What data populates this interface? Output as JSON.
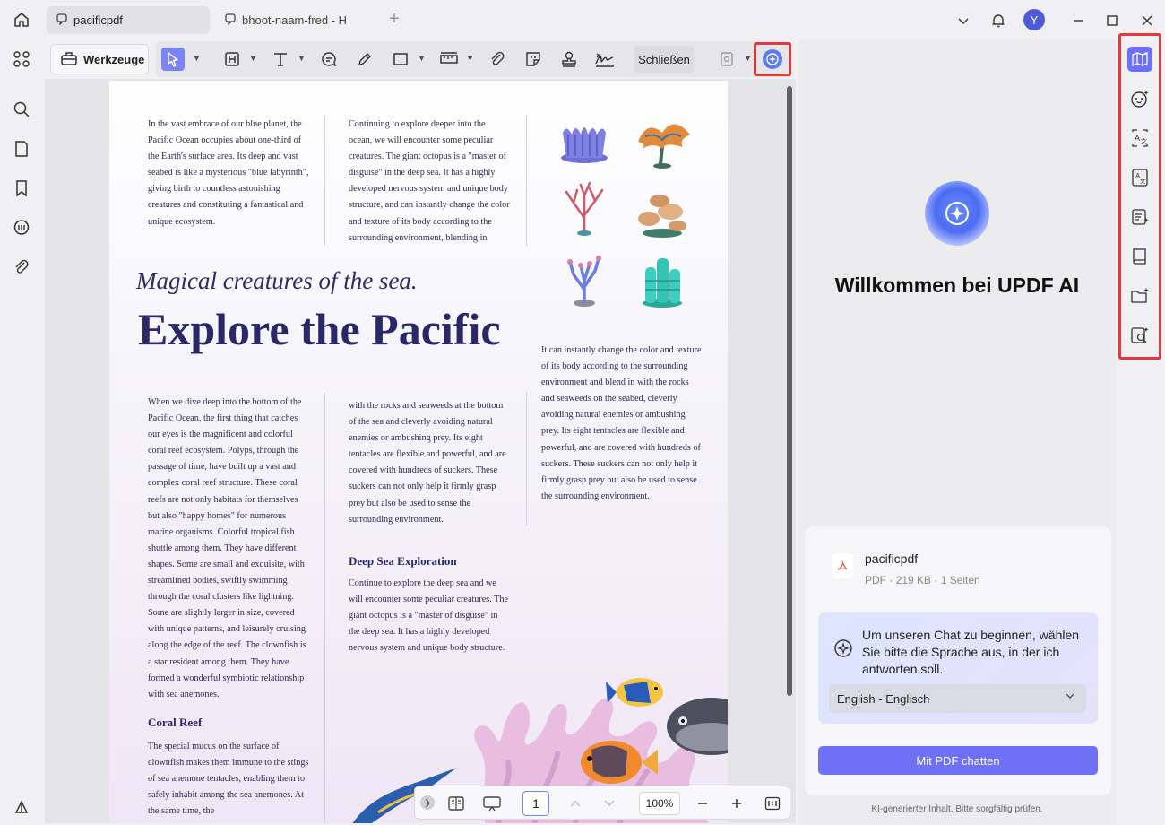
{
  "tabs": {
    "active_label": "pacificpdf",
    "inactive_label": "bhoot-naam-fred - H"
  },
  "user": {
    "avatar_initial": "Y"
  },
  "toolbar": {
    "tools_label": "Werkzeuge",
    "close_label": "Schließen"
  },
  "document": {
    "col1_top": "In the vast embrace of our blue planet, the Pacific Ocean occupies about one-third of the Earth's surface area. Its deep and vast seabed is like a mysterious \"blue labyrinth\", giving birth to countless astonishing creatures and constituting a fantastical and unique ecosystem.",
    "col2_top": "Continuing to explore deeper into the ocean, we will encounter some peculiar creatures. The giant octopus is a \"master of disguise\" in the deep sea. It has a highly developed nervous system and unique body structure, and can instantly change the color and texture of its body according to the surrounding environment, blending in",
    "subtitle": "Magical creatures of the sea.",
    "title": "Explore the Pacific",
    "col3_mid": "It can instantly change the color and texture of its body according to the surrounding environment and blend in with the rocks and seaweeds on the seabed, cleverly avoiding natural enemies or ambushing prey. Its eight tentacles are flexible and powerful, and are covered with hundreds of suckers. These suckers can not only help it firmly grasp prey but also be used to sense the surrounding environment.",
    "col1_bottom": "When we dive deep into the bottom of the Pacific Ocean, the first thing that catches our eyes is the magnificent and colorful coral reef ecosystem. Polyps, through the passage of time, have built up a vast and complex coral reef structure. These coral reefs are not only habitats for themselves but also \"happy homes\" for numerous marine organisms. Colorful tropical fish shuttle among them. They have different shapes. Some are small and exquisite, with streamlined bodies, swiftly swimming through the coral clusters like lightning. Some are slightly larger in size, covered with unique patterns, and leisurely cruising along the edge of the reef. The clownfish is a star resident among them. They have formed a wonderful symbiotic relationship with sea anemones.",
    "col2_bottom": "with the rocks and seaweeds at the bottom of the sea and cleverly avoiding natural enemies or ambushing prey. Its eight tentacles are flexible and powerful, and are covered with hundreds of suckers. These suckers can not only help it firmly grasp prey but also be used to sense the surrounding environment.",
    "heading_deep": "Deep Sea Exploration",
    "deep_text": "Continue to explore the deep sea and we will encounter some peculiar creatures. The giant octopus is a \"master of disguise\" in the deep sea. It has a highly developed nervous system and unique body structure.",
    "heading_coral": "Coral Reef",
    "coral_text": "The special mucus on the surface of clownfish makes them immune to the stings of sea anemone tentacles, enabling them to safely inhabit among the sea anemones. At the same time, the"
  },
  "nav": {
    "page_number": "1",
    "zoom": "100%"
  },
  "ai_panel": {
    "welcome": "Willkommen bei UPDF AI",
    "file_name": "pacificpdf",
    "file_meta": "PDF · 219 KB · 1 Seiten",
    "language_prompt": "Um unseren Chat zu beginnen, wählen Sie bitte die Sprache aus, in der ich antworten soll.",
    "language_selected": "English - Englisch",
    "chat_button": "Mit PDF chatten",
    "disclaimer": "KI-generierter Inhalt. Bitte sorgfältig prüfen."
  },
  "colors": {
    "accent": "#6e70f6",
    "highlight_red": "#e4393c",
    "title_navy": "#2a2866"
  }
}
